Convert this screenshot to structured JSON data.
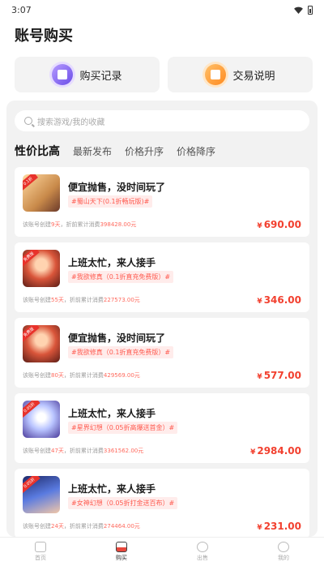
{
  "status": {
    "time": "3:07"
  },
  "page": {
    "title": "账号购买"
  },
  "top_cards": [
    {
      "label": "购买记录",
      "icon": "purchase-record-icon",
      "color": "#7b5cf0"
    },
    {
      "label": "交易说明",
      "icon": "trade-guide-icon",
      "color": "#ff8a1f"
    }
  ],
  "search": {
    "placeholder": "搜索游戏/我的收藏"
  },
  "tabs": [
    {
      "label": "性价比高",
      "active": true
    },
    {
      "label": "最新发布",
      "active": false
    },
    {
      "label": "价格升序",
      "active": false
    },
    {
      "label": "价格降序",
      "active": false
    }
  ],
  "listings": [
    {
      "title": "便宜抛售，没时间玩了",
      "tag": "#蜀山天下(0.1折畅玩版)#",
      "meta_prefix": "该账号创建",
      "days": "9天",
      "meta_mid": "，折前累计消费",
      "spent": "398428.00元",
      "currency": "¥",
      "price": "690.00",
      "badge": "0.1折"
    },
    {
      "title": "上班太忙，来人接手",
      "tag": "#我欲修真（0.1折直充免费版）#",
      "meta_prefix": "该账号创建",
      "days": "55天",
      "meta_mid": "，折前累计消费",
      "spent": "227573.00元",
      "currency": "¥",
      "price": "346.00",
      "badge": "免费版"
    },
    {
      "title": "便宜抛售，没时间玩了",
      "tag": "#我欲修真（0.1折直充免费版）#",
      "meta_prefix": "该账号创建",
      "days": "80天",
      "meta_mid": "，折前累计消费",
      "spent": "429569.00元",
      "currency": "¥",
      "price": "577.00",
      "badge": "免费版"
    },
    {
      "title": "上班太忙，来人接手",
      "tag": "#星界幻想（0.05折高爆送首金）#",
      "meta_prefix": "该账号创建",
      "days": "47天",
      "meta_mid": "，折前累计消费",
      "spent": "3361562.00元",
      "currency": "¥",
      "price": "2984.00",
      "badge": "0.05折"
    },
    {
      "title": "上班太忙，来人接手",
      "tag": "#女神幻想（0.05折打金送百布）#",
      "meta_prefix": "该账号创建",
      "days": "24天",
      "meta_mid": "，折前累计消费",
      "spent": "274464.00元",
      "currency": "¥",
      "price": "231.00",
      "badge": "0.05折"
    }
  ],
  "tabbar": [
    {
      "label": "首页",
      "icon": "home-icon",
      "active": false
    },
    {
      "label": "购买",
      "icon": "shop-bag-icon",
      "active": true
    },
    {
      "label": "出售",
      "icon": "sell-coin-icon",
      "active": false
    },
    {
      "label": "我的",
      "icon": "profile-icon",
      "active": false
    }
  ],
  "colors": {
    "accent": "#f2402f",
    "tag_bg": "#ffeceb",
    "panel_bg": "#f2f2f2"
  }
}
